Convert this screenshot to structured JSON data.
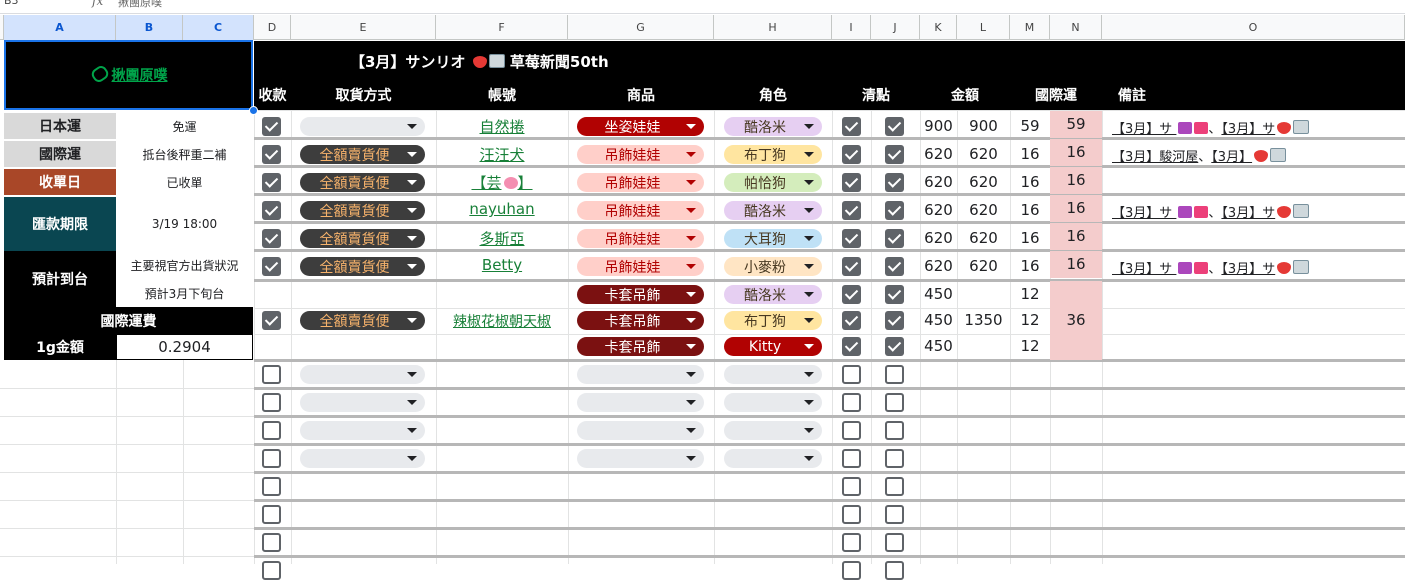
{
  "formula_bar": {
    "cell_ref": "B3",
    "fx": "fx",
    "value": "揪團原噗"
  },
  "columns": [
    "A",
    "B",
    "C",
    "D",
    "E",
    "F",
    "G",
    "H",
    "I",
    "J",
    "K",
    "L",
    "M",
    "N",
    "O"
  ],
  "left_panel": {
    "link_text": "揪團原噗",
    "rows": [
      {
        "label": "日本運",
        "value": "免運"
      },
      {
        "label": "國際運",
        "value": "抵台後秤重二補"
      },
      {
        "label": "收單日",
        "value": "已收單"
      },
      {
        "label": "匯款期限",
        "value": "3/19 18:00"
      },
      {
        "label": "預計到台",
        "value": "主要視官方出貨狀況",
        "value2": "預計3月下旬台"
      },
      {
        "label": "國際運費"
      },
      {
        "label": "1g金額",
        "value": "0.2904"
      }
    ]
  },
  "title": "【3月】サンリオ 草莓新聞50th",
  "headers": {
    "paid": "收款",
    "pickup": "取貨方式",
    "account": "帳號",
    "product": "商品",
    "character": "角色",
    "check": "清點",
    "amount": "金額",
    "intl": "國際運",
    "note": "備註"
  },
  "orders": [
    {
      "paid": true,
      "pickup": "",
      "account": "自然捲",
      "product": "坐姿娃娃",
      "character": "酷洛米",
      "c1": true,
      "c2": true,
      "k": "900",
      "l": "900",
      "m": "59",
      "n": "59",
      "note": "【3月】サ 、【3月】サ"
    },
    {
      "paid": true,
      "pickup": "全額賣貨便",
      "account": "汪汪犬",
      "product": "吊飾娃娃",
      "character": "布丁狗",
      "c1": true,
      "c2": true,
      "k": "620",
      "l": "620",
      "m": "16",
      "n": "16",
      "note": "【3月】駿河屋、【3月】"
    },
    {
      "paid": true,
      "pickup": "全額賣貨便",
      "account": "【芸 】",
      "product": "吊飾娃娃",
      "character": "帕恰狗",
      "c1": true,
      "c2": true,
      "k": "620",
      "l": "620",
      "m": "16",
      "n": "16",
      "note": ""
    },
    {
      "paid": true,
      "pickup": "全額賣貨便",
      "account": "nayuhan",
      "product": "吊飾娃娃",
      "character": "酷洛米",
      "c1": true,
      "c2": true,
      "k": "620",
      "l": "620",
      "m": "16",
      "n": "16",
      "note": "【3月】サ 、【3月】サ"
    },
    {
      "paid": true,
      "pickup": "全額賣貨便",
      "account": "多斯亞",
      "product": "吊飾娃娃",
      "character": "大耳狗",
      "c1": true,
      "c2": true,
      "k": "620",
      "l": "620",
      "m": "16",
      "n": "16",
      "note": ""
    },
    {
      "paid": true,
      "pickup": "全額賣貨便",
      "account": "Betty",
      "product": "吊飾娃娃",
      "character": "小麥粉",
      "c1": true,
      "c2": true,
      "k": "620",
      "l": "620",
      "m": "16",
      "n": "16",
      "note": "【3月】サ 、【3月】サ"
    }
  ],
  "group_order": {
    "paid": true,
    "pickup": "全額賣貨便",
    "account": "辣椒花椒朝天椒",
    "l": "1350",
    "n": "36",
    "items": [
      {
        "product": "卡套吊飾",
        "character": "酷洛米",
        "c1": true,
        "c2": true,
        "k": "450",
        "m": "12"
      },
      {
        "product": "卡套吊飾",
        "character": "布丁狗",
        "c1": true,
        "c2": true,
        "k": "450",
        "m": "12"
      },
      {
        "product": "卡套吊飾",
        "character": "Kitty",
        "c1": true,
        "c2": true,
        "k": "450",
        "m": "12"
      }
    ]
  },
  "colors": {
    "product_red": "#b10202",
    "product_pink": "#ffcfc9",
    "product_dark": "#7b1111",
    "pickup_dark": "#3d3d3d",
    "char": {
      "酷洛米": "#e6cff2",
      "布丁狗": "#ffe5a0",
      "帕恰狗": "#d4edbc",
      "大耳狗": "#bfe1f6",
      "小麥粉": "#ffe5c4",
      "Kitty": "#b10202"
    },
    "intl_pink": "#f4cccc",
    "left_grey": "#d9d9d9",
    "left_red": "#a94728",
    "left_teal": "#0a4651"
  }
}
